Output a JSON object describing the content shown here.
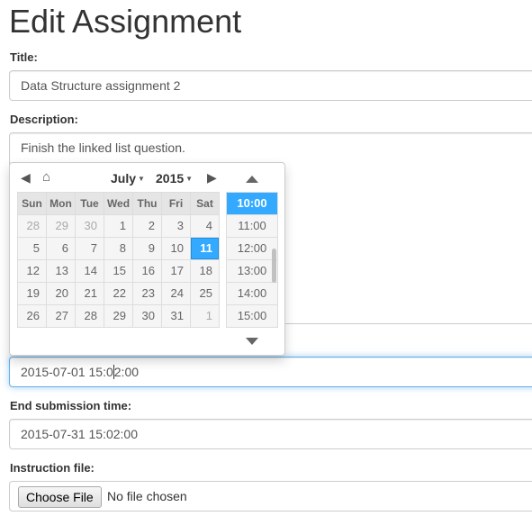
{
  "page": {
    "title": "Edit Assignment"
  },
  "form": {
    "title_label": "Title:",
    "title_value": "Data Structure assignment 2",
    "description_label": "Description:",
    "description_value": "Finish the linked list question.",
    "start_value_before_caret": "2015-07-01 15:0",
    "start_value_after_caret": "2:00",
    "end_label": "End submission time:",
    "end_value": "2015-07-31 15:02:00",
    "instruction_label": "Instruction file:",
    "choose_file_label": "Choose File",
    "file_status": "No file chosen"
  },
  "datepicker": {
    "month": "July",
    "year": "2015",
    "weekdays": [
      "Sun",
      "Mon",
      "Tue",
      "Wed",
      "Thu",
      "Fri",
      "Sat"
    ],
    "weeks": [
      [
        "28",
        "29",
        "30",
        "1",
        "2",
        "3",
        "4"
      ],
      [
        "5",
        "6",
        "7",
        "8",
        "9",
        "10",
        "11"
      ],
      [
        "12",
        "13",
        "14",
        "15",
        "16",
        "17",
        "18"
      ],
      [
        "19",
        "20",
        "21",
        "22",
        "23",
        "24",
        "25"
      ],
      [
        "26",
        "27",
        "28",
        "29",
        "30",
        "31",
        "1"
      ]
    ],
    "selected_day": "11",
    "times": [
      "10:00",
      "11:00",
      "12:00",
      "13:00",
      "14:00",
      "15:00"
    ],
    "selected_time": "10:00",
    "accent_color": "#33aaff"
  }
}
